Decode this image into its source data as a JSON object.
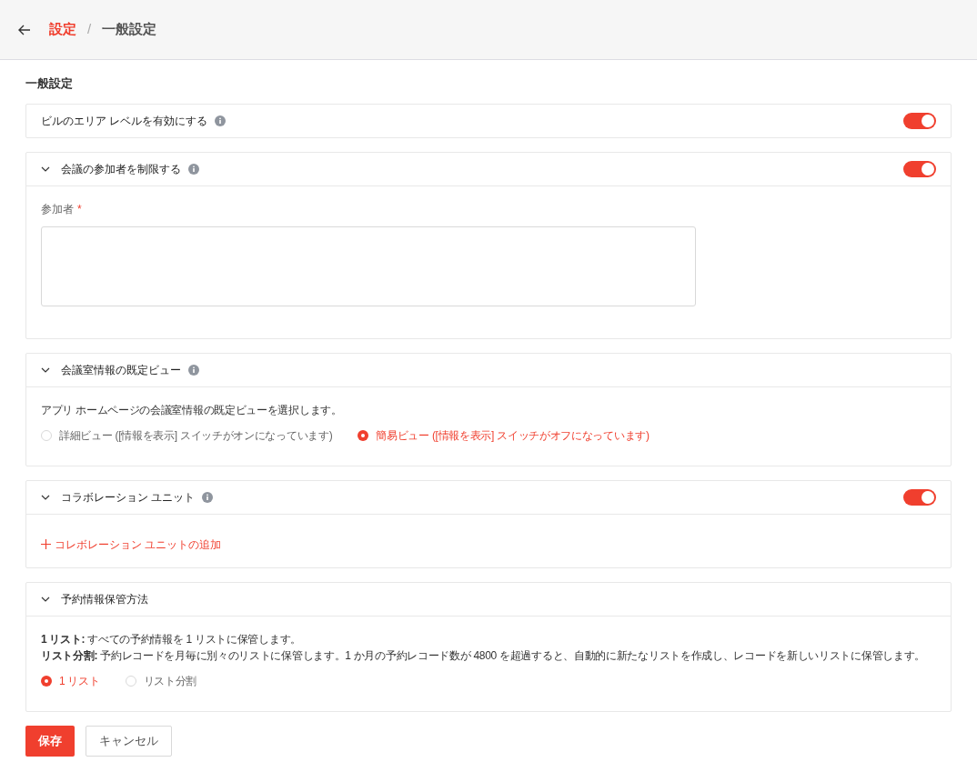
{
  "header": {
    "breadcrumb": [
      {
        "label": "設定",
        "kind": "link"
      },
      {
        "label": "/",
        "kind": "separator"
      },
      {
        "label": "一般設定",
        "kind": "current"
      }
    ]
  },
  "page_title": "一般設定",
  "sections": [
    {
      "kind": "toggle_row",
      "title": "ビルのエリア レベルを有効にする",
      "info": true,
      "on": true
    },
    {
      "kind": "participants",
      "title": "会議の参加者を制限する",
      "info": true,
      "expanded": true,
      "on": true,
      "field_label": "参加者",
      "required_mark": "*"
    },
    {
      "kind": "radio",
      "title": "会議室情報の既定ビュー",
      "info": true,
      "expanded": true,
      "description": [
        "アプリ ホームページの会議室情報の既定ビューを選択します。"
      ],
      "options": [
        {
          "label": "詳細ビュー ([情報を表示] スイッチがオンになっています)",
          "selected": false
        },
        {
          "label": "簡易ビュー ([情報を表示] スイッチがオフになっています)",
          "selected": true
        }
      ]
    },
    {
      "kind": "collab",
      "title": "コラボレーション ユニット",
      "info": true,
      "expanded": true,
      "on": true,
      "add_link": "コレボレーション ユニットの追加"
    },
    {
      "kind": "radio",
      "title": "予約情報保管方法",
      "info": false,
      "expanded": true,
      "description": [
        "**1 リスト:** すべての予約情報を 1 リストに保管します。",
        "**リスト分割:** 予約レコードを月毎に別々のリストに保管します。1 か月の予約レコード数が 4800 を超過すると、自動的に新たなリストを作成し、レコードを新しいリストに保管します。"
      ],
      "options": [
        {
          "label": "1 リスト",
          "selected": true
        },
        {
          "label": "リスト分割",
          "selected": false
        }
      ]
    }
  ],
  "buttons": [
    {
      "label": "保存",
      "kind": "primary"
    },
    {
      "label": "キャンセル",
      "kind": "secondary"
    }
  ]
}
